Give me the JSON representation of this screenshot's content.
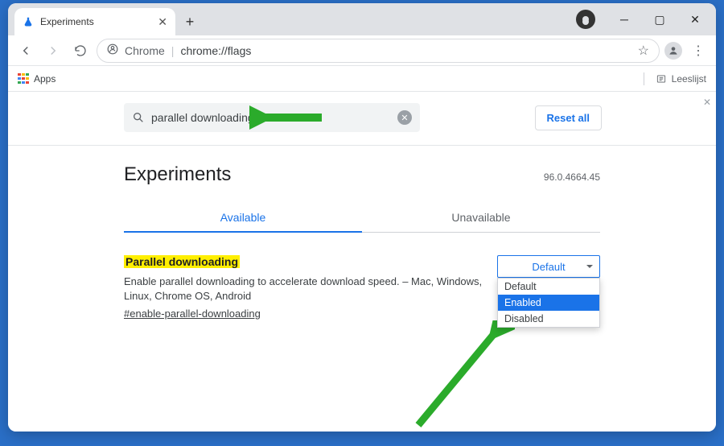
{
  "window": {
    "tab_title": "Experiments",
    "account_circle": true
  },
  "toolbar": {
    "omnibox_brand": "Chrome",
    "omnibox_url": "chrome://flags"
  },
  "bookmarks": {
    "apps_label": "Apps",
    "reading_list_label": "Leeslijst"
  },
  "flags": {
    "search_value": "parallel downloading",
    "reset_label": "Reset all",
    "heading": "Experiments",
    "version": "96.0.4664.45",
    "tabs": {
      "available": "Available",
      "unavailable": "Unavailable"
    },
    "entry": {
      "title": "Parallel downloading",
      "description": "Enable parallel downloading to accelerate download speed. – Mac, Windows, Linux, Chrome OS, Android",
      "hash": "#enable-parallel-downloading",
      "select": {
        "current": "Default",
        "options": [
          "Default",
          "Enabled",
          "Disabled"
        ],
        "highlighted": "Enabled"
      }
    }
  },
  "colors": {
    "accent": "#1a73e8",
    "arrow": "#2bab2b"
  }
}
